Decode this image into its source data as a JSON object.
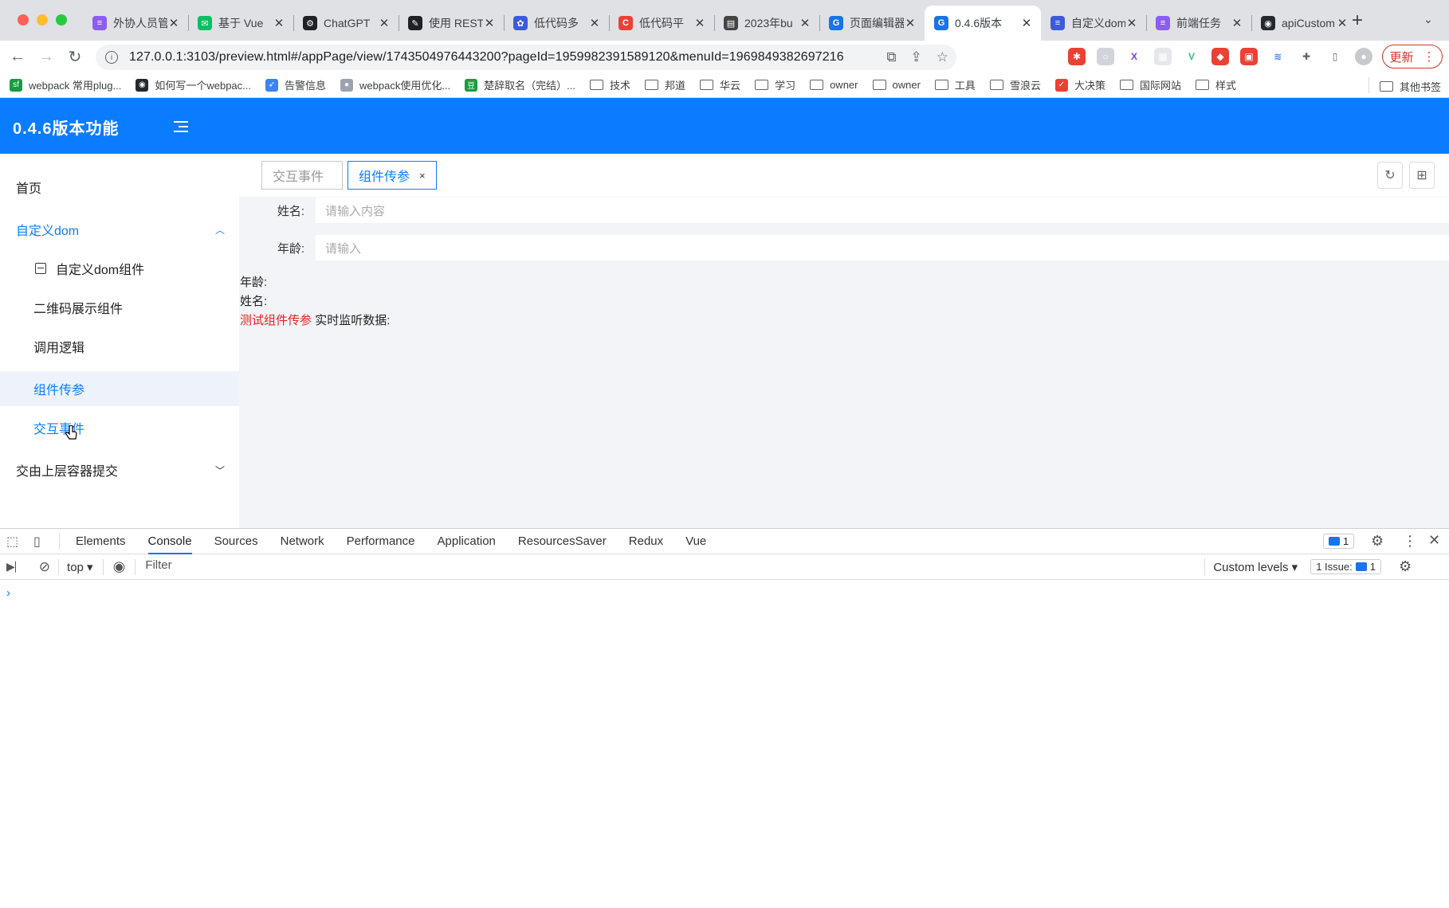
{
  "browser": {
    "tabs": [
      {
        "title": "外协人员管",
        "color": "#8b5cf6",
        "glyph": "≡"
      },
      {
        "title": "基于 Vue",
        "color": "#07c160",
        "glyph": "✉"
      },
      {
        "title": "ChatGPT",
        "color": "#202124",
        "glyph": "⚙"
      },
      {
        "title": "使用 REST",
        "color": "#202124",
        "glyph": "✎"
      },
      {
        "title": "低代码多",
        "color": "#3b5bdb",
        "glyph": "✿"
      },
      {
        "title": "低代码平",
        "color": "#e94235",
        "glyph": "C"
      },
      {
        "title": "2023年bu",
        "color": "#444444",
        "glyph": "▤"
      },
      {
        "title": "页面编辑器",
        "color": "#1a73e8",
        "glyph": "G"
      },
      {
        "title": "0.4.6版本",
        "color": "#1a73e8",
        "glyph": "G"
      },
      {
        "title": "自定义dom",
        "color": "#3b5bdb",
        "glyph": "≡"
      },
      {
        "title": "前端任务",
        "color": "#8b5cf6",
        "glyph": "≡"
      },
      {
        "title": "apiCustom",
        "color": "#24292f",
        "glyph": "◉"
      }
    ],
    "active_tab_index": 8,
    "new_tab": "+",
    "url": "127.0.0.1:3103/preview.html#/appPage/view/1743504976443200?pageId=1959982391589120&menuId=1969849382697216",
    "update_label": "更新",
    "bookmarks": [
      {
        "label": "webpack 常用plug...",
        "icon": "sf",
        "color": "#1a9c3e"
      },
      {
        "label": "如何写一个webpac...",
        "icon": "◉",
        "color": "#24292f"
      },
      {
        "label": "告警信息",
        "icon": "➶",
        "color": "#3b82f6"
      },
      {
        "label": "webpack使用优化...",
        "icon": "●",
        "color": "#9ca3af"
      },
      {
        "label": "楚辞取名（完结）...",
        "icon": "豆",
        "color": "#1a9c3e"
      },
      {
        "label": "技术",
        "icon": "folder"
      },
      {
        "label": "邦道",
        "icon": "folder"
      },
      {
        "label": "华云",
        "icon": "folder"
      },
      {
        "label": "学习",
        "icon": "folder"
      },
      {
        "label": "owner",
        "icon": "folder"
      },
      {
        "label": "owner",
        "icon": "folder"
      },
      {
        "label": "工具",
        "icon": "folder"
      },
      {
        "label": "雪浪云",
        "icon": "folder"
      },
      {
        "label": "大决策",
        "icon": "✓",
        "color": "#e94235"
      },
      {
        "label": "国际网站",
        "icon": "folder"
      },
      {
        "label": "样式",
        "icon": "folder"
      }
    ],
    "other_bookmarks": "其他书签"
  },
  "app": {
    "title": "0.4.6版本功能",
    "sidebar": {
      "items": [
        {
          "label": "首页"
        },
        {
          "label": "自定义dom"
        },
        {
          "label": "自定义dom组件"
        },
        {
          "label": "二维码展示组件"
        },
        {
          "label": "调用逻辑"
        },
        {
          "label": "组件传参"
        },
        {
          "label": "交互事件"
        },
        {
          "label": "交由上层容器提交"
        }
      ]
    },
    "tags": [
      {
        "label": "交互事件"
      },
      {
        "label": "组件传参",
        "close": "×"
      }
    ],
    "form": {
      "name_label": "姓名:",
      "name_placeholder": "请输入内容",
      "age_label": "年龄:",
      "age_placeholder": "请输入"
    },
    "output": {
      "age_line": "年龄:",
      "name_line": "姓名:",
      "test_label": "测试组件传参",
      "monitor_label": "实时监听数据:"
    }
  },
  "devtools": {
    "tabs": [
      "Elements",
      "Console",
      "Sources",
      "Network",
      "Performance",
      "Application",
      "ResourcesSaver",
      "Redux",
      "Vue"
    ],
    "active_tab": "Console",
    "message_count": "1",
    "context": "top",
    "filter_placeholder": "Filter",
    "levels": "Custom levels",
    "issues_label": "1 Issue:",
    "issues_count": "1",
    "prompt": "›"
  }
}
